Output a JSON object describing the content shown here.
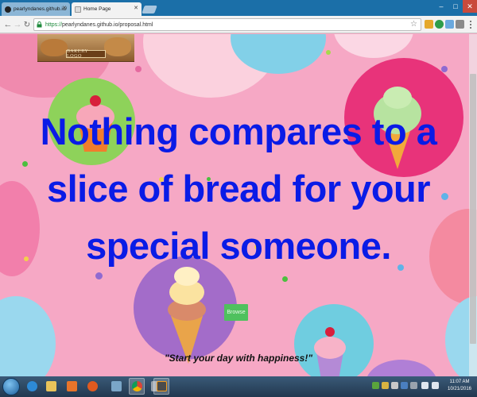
{
  "browser": {
    "tabs": [
      {
        "label": "pearlyndanes.github.io/",
        "active": false
      },
      {
        "label": "Home Page",
        "active": true
      }
    ],
    "url_scheme": "https://",
    "url_rest": "pearlyndanes.github.io/proposal.html"
  },
  "page": {
    "logo_text": "BAKERY LOGO",
    "headline": "Nothing compares to a slice of bread for your special someone.",
    "browse_label": "Browse",
    "tagline": "\"Start your day with happiness!\"",
    "colors": {
      "background": "#f6a8c5",
      "headline": "#0a1be6",
      "button": "#4fc15e"
    }
  },
  "taskbar": {
    "icons": [
      "windows-start-icon",
      "ie-icon",
      "file-explorer-icon",
      "media-player-icon",
      "firefox-icon",
      "network-app-icon",
      "chrome-icon",
      "app-icon",
      "sublime-text-icon"
    ],
    "time": "11:07 AM",
    "date": "10/21/2016"
  }
}
